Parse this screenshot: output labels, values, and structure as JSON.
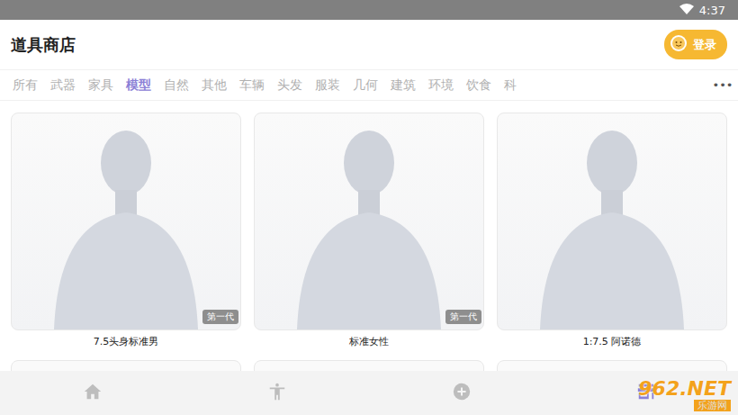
{
  "status_bar": {
    "time": "4:37"
  },
  "header": {
    "title": "道具商店",
    "login_button": "登录"
  },
  "tabs": [
    {
      "label": "所有",
      "selected": false
    },
    {
      "label": "武器",
      "selected": false
    },
    {
      "label": "家具",
      "selected": false
    },
    {
      "label": "模型",
      "selected": true
    },
    {
      "label": "自然",
      "selected": false
    },
    {
      "label": "其他",
      "selected": false
    },
    {
      "label": "车辆",
      "selected": false
    },
    {
      "label": "头发",
      "selected": false
    },
    {
      "label": "服装",
      "selected": false
    },
    {
      "label": "几何",
      "selected": false
    },
    {
      "label": "建筑",
      "selected": false
    },
    {
      "label": "环境",
      "selected": false
    },
    {
      "label": "饮食",
      "selected": false
    },
    {
      "label": "科",
      "selected": false
    }
  ],
  "more": "•••",
  "cards": [
    {
      "name": "7.5头身标准男",
      "badge": "第一代"
    },
    {
      "name": "标准女性",
      "badge": "第一代"
    },
    {
      "name": "1:7.5 阿诺德"
    }
  ],
  "bottom_nav": [
    {
      "kind": "home",
      "selected": false
    },
    {
      "kind": "pose",
      "selected": false
    },
    {
      "kind": "add",
      "selected": false
    },
    {
      "kind": "store",
      "selected": true
    }
  ],
  "watermark": {
    "text": "962.NET",
    "subtext": "乐游网"
  }
}
